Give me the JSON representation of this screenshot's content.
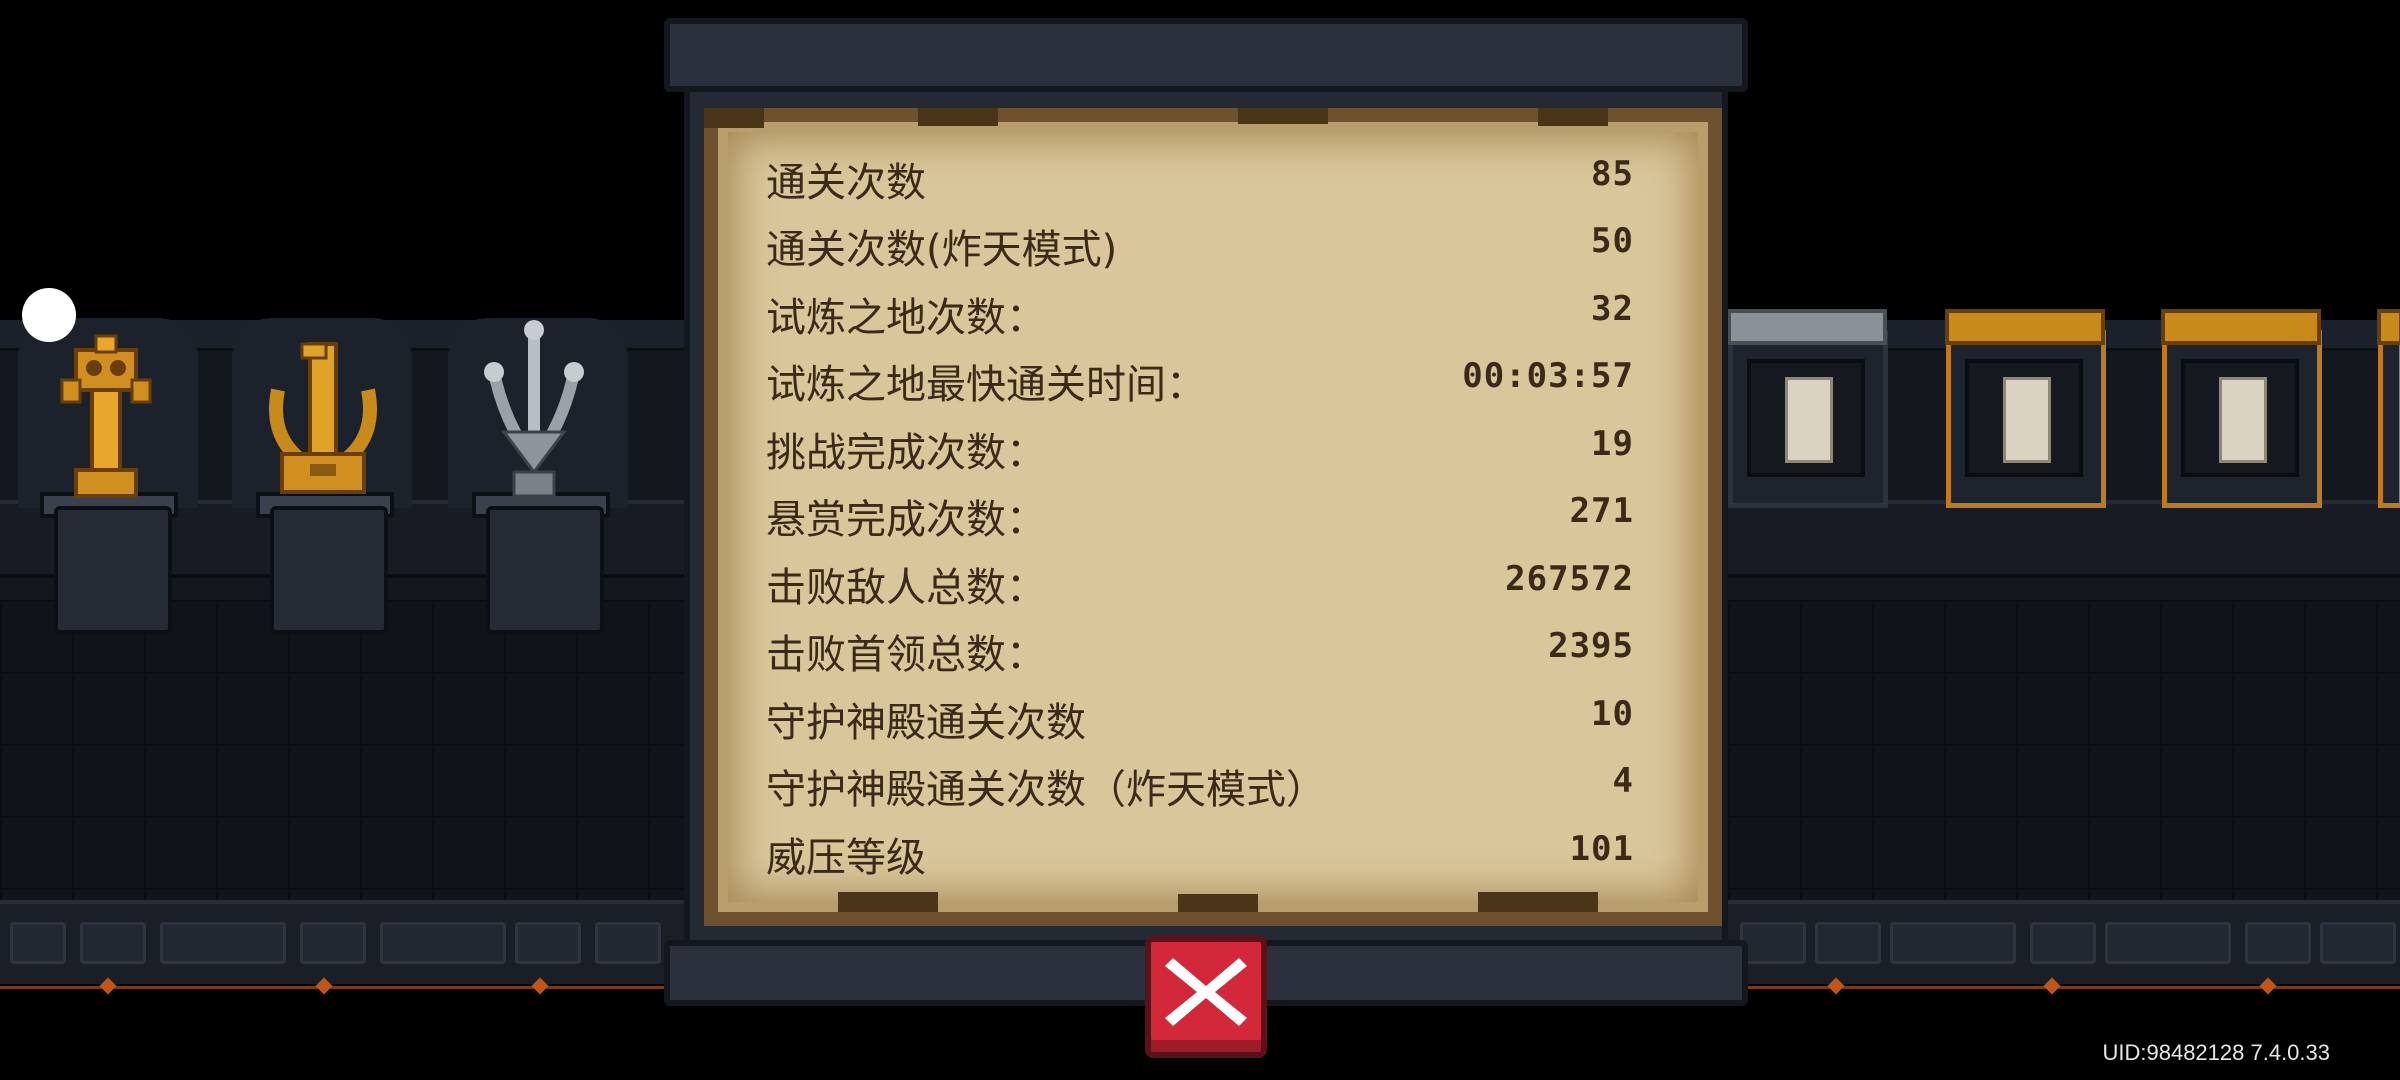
{
  "stats": [
    {
      "label": "通关次数",
      "value": "85"
    },
    {
      "label": "通关次数(炸天模式)",
      "value": "50"
    },
    {
      "label": "试炼之地次数：",
      "value": "32"
    },
    {
      "label": "试炼之地最快通关时间：",
      "value": "00:03:57"
    },
    {
      "label": "挑战完成次数：",
      "value": "19"
    },
    {
      "label": "悬赏完成次数：",
      "value": "271"
    },
    {
      "label": "击败敌人总数：",
      "value": "267572"
    },
    {
      "label": "击败首领总数：",
      "value": "2395"
    },
    {
      "label": "守护神殿通关次数",
      "value": "10"
    },
    {
      "label": "守护神殿通关次数（炸天模式）",
      "value": "4"
    },
    {
      "label": "威压等级",
      "value": "101"
    }
  ],
  "footer": {
    "uid_text": "UID:98482128 7.4.0.33"
  },
  "icons": {
    "close": "close-x-icon",
    "trophies": [
      "gold-robot-trophy-icon",
      "laurel-number-one-trophy-icon",
      "silver-plant-trophy-icon"
    ]
  },
  "colors": {
    "close_button": "#d3273a",
    "parchment": "#d9c79b",
    "text": "#3a2a17"
  }
}
